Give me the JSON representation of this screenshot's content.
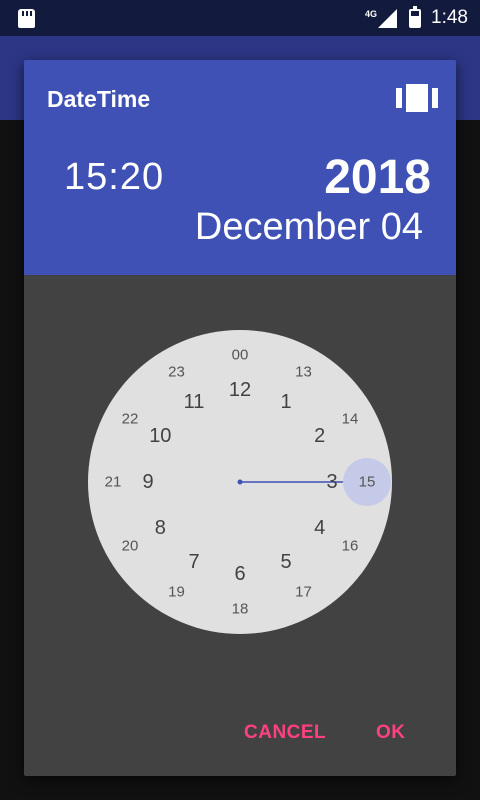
{
  "status_bar": {
    "network": "4G",
    "time": "1:48",
    "icons": [
      "sd-card-icon",
      "signal-icon",
      "battery-icon"
    ]
  },
  "dialog": {
    "title": "DateTime",
    "toggle_icon": "view-carousel-icon",
    "time": "15:20",
    "year": "2018",
    "date": "December 04",
    "clock": {
      "selected_hour": "15",
      "outer": [
        "12",
        "1",
        "2",
        "3",
        "4",
        "5",
        "6",
        "7",
        "8",
        "9",
        "10",
        "11"
      ],
      "inner": [
        "00",
        "13",
        "14",
        "15",
        "16",
        "17",
        "18",
        "19",
        "20",
        "21",
        "22",
        "23"
      ]
    },
    "cancel_label": "CANCEL",
    "ok_label": "OK"
  },
  "colors": {
    "header": "#3f51b5",
    "dialog_body": "#424242",
    "clock_face": "#e0e0e0",
    "accent": "#ff4081",
    "selector": "#c5cae9",
    "hand": "#3f51b5"
  }
}
